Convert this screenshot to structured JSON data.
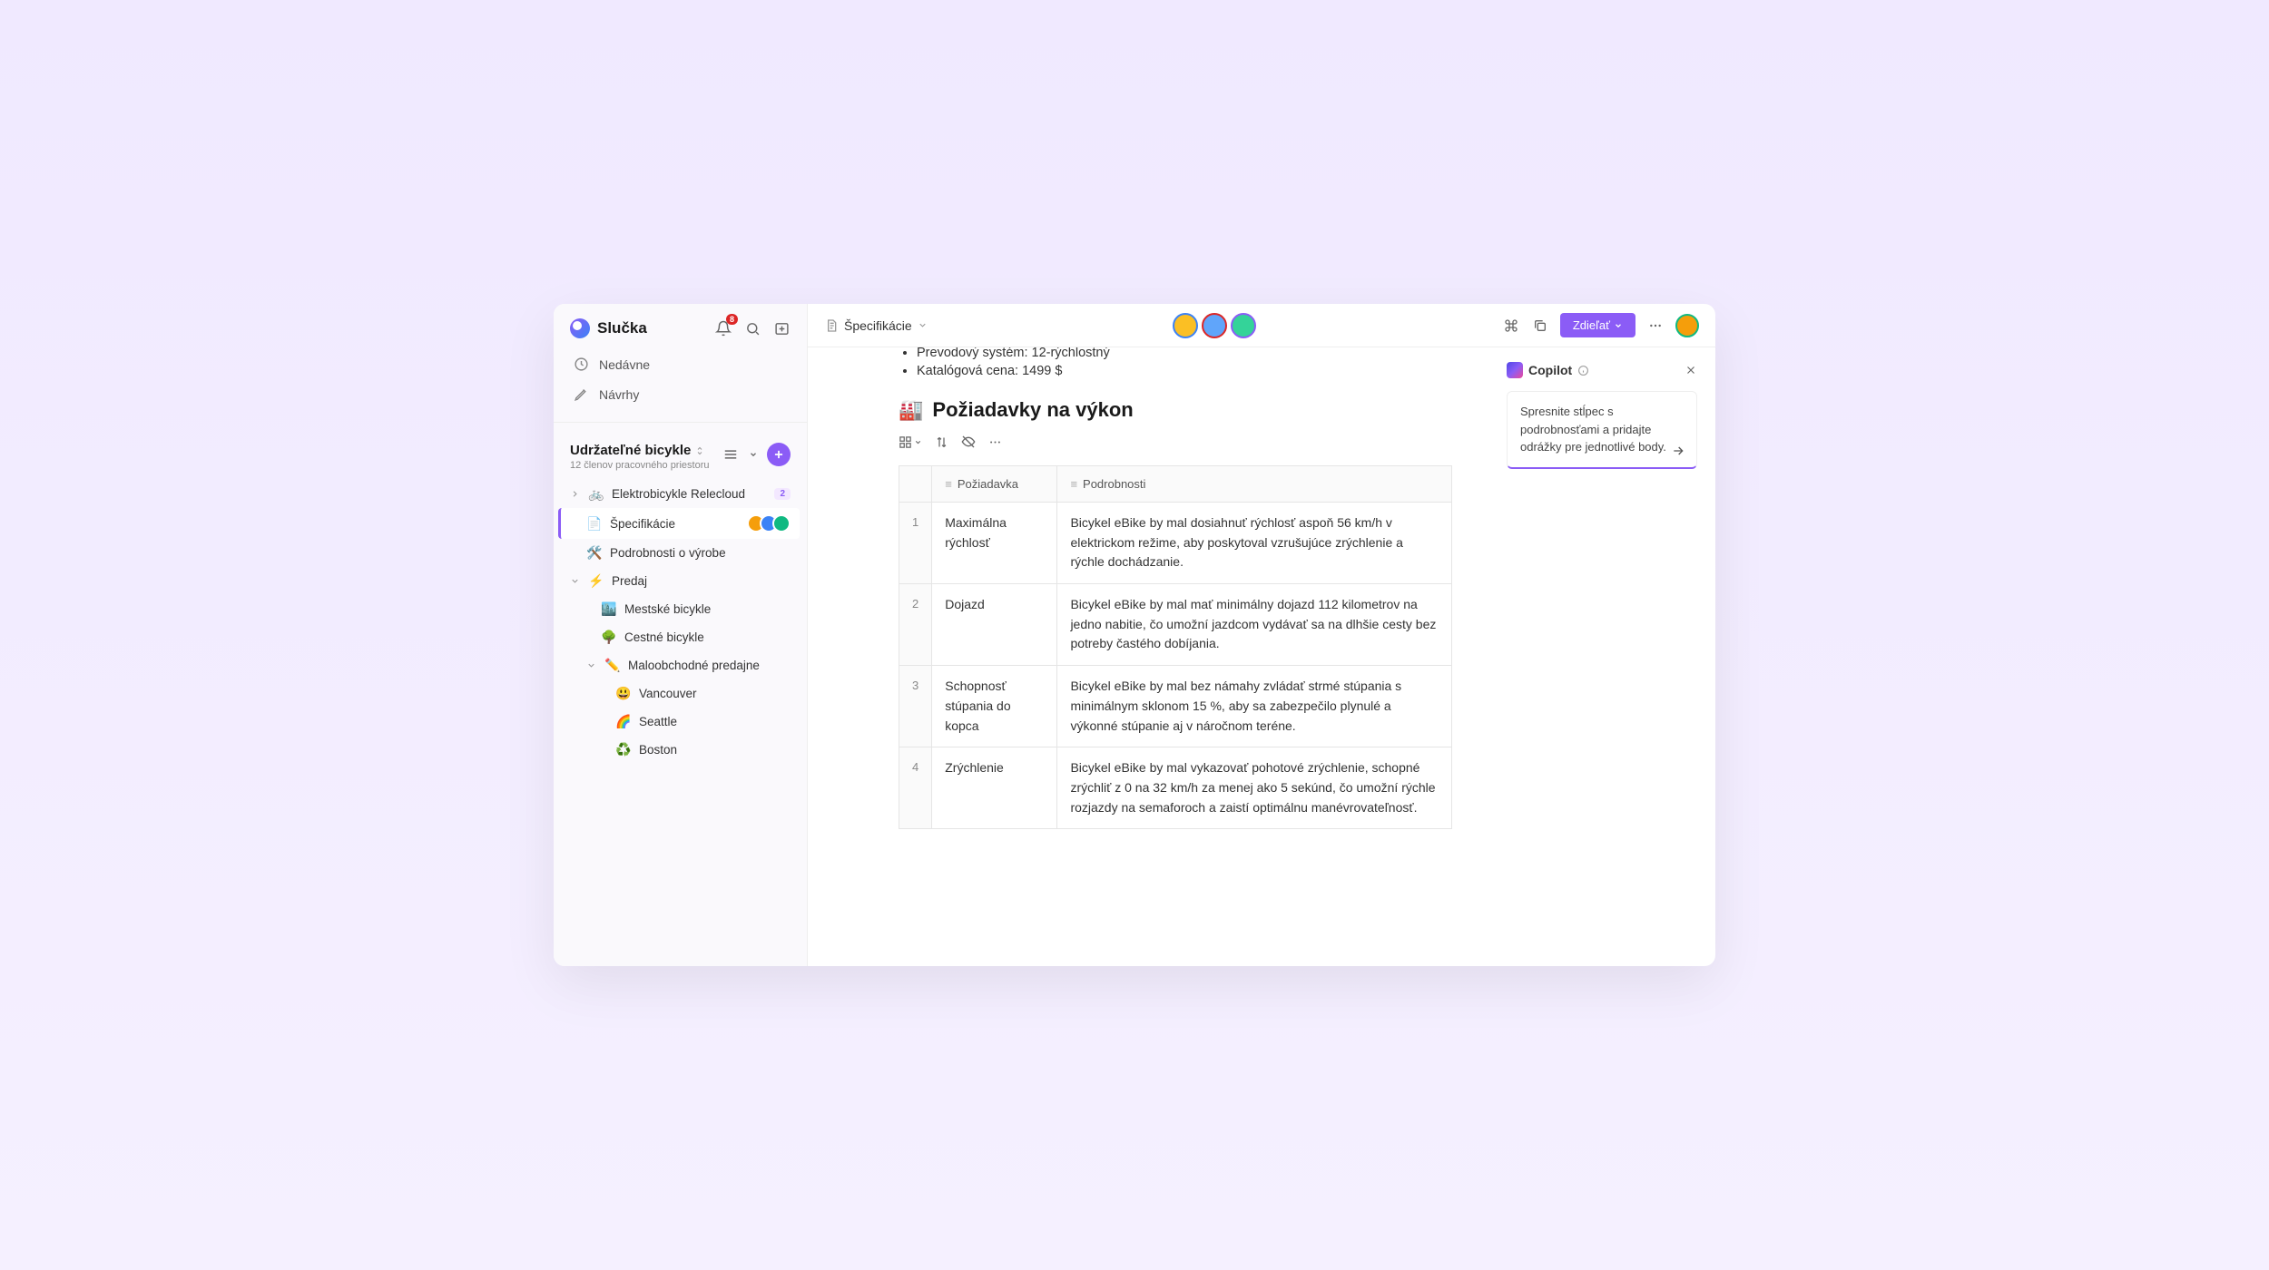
{
  "app": {
    "name": "Slučka",
    "notification_count": "8"
  },
  "nav": {
    "recent": "Nedávne",
    "drafts": "Návrhy"
  },
  "workspace": {
    "title": "Udržateľné bicykle",
    "members": "12 členov pracovného priestoru"
  },
  "tree": {
    "root": {
      "label": "Elektrobicykle Relecloud",
      "count": "2"
    },
    "spec": {
      "label": "Špecifikácie"
    },
    "mfg": {
      "label": "Podrobnosti o výrobe"
    },
    "sales": {
      "label": "Predaj"
    },
    "city": {
      "label": "Mestské bicykle"
    },
    "road": {
      "label": "Cestné bicykle"
    },
    "retail": {
      "label": "Maloobchodné predajne"
    },
    "vancouver": {
      "label": "Vancouver"
    },
    "seattle": {
      "label": "Seattle"
    },
    "boston": {
      "label": "Boston"
    }
  },
  "breadcrumb": {
    "title": "Špecifikácie"
  },
  "share_button": "Zdieľať",
  "doc": {
    "bullets": [
      "Prevodový systém: 12-rýchlostný",
      "Katalógová cena: 1499 $"
    ],
    "heading_emoji": "🏭",
    "heading": "Požiadavky na výkon",
    "columns": {
      "req": "Požiadavka",
      "detail": "Podrobnosti"
    },
    "rows": [
      {
        "n": "1",
        "req": "Maximálna rýchlosť",
        "detail": "Bicykel eBike by mal dosiahnuť rýchlosť aspoň 56 km/h v elektrickom režime, aby poskytoval vzrušujúce zrýchlenie a rýchle dochádzanie."
      },
      {
        "n": "2",
        "req": "Dojazd",
        "detail": "Bicykel eBike by mal mať minimálny dojazd 112 kilometrov na jedno nabitie, čo umožní jazdcom vydávať sa na dlhšie cesty bez potreby častého dobíjania."
      },
      {
        "n": "3",
        "req": "Schopnosť stúpania do kopca",
        "detail": "Bicykel eBike by mal bez námahy zvládať strmé stúpania s minimálnym sklonom 15 %, aby sa zabezpečilo plynulé a výkonné stúpanie aj v náročnom teréne."
      },
      {
        "n": "4",
        "req": "Zrýchlenie",
        "detail": "Bicykel eBike by mal vykazovať pohotové zrýchlenie, schopné zrýchliť z 0 na 32 km/h za menej ako 5 sekúnd, čo umožní rýchle rozjazdy na semaforoch a zaistí optimálnu manévrovateľnosť."
      }
    ]
  },
  "copilot": {
    "title": "Copilot",
    "prompt": "Spresnite stĺpec s podrobnosťami a pridajte odrážky pre jednotlivé body."
  }
}
